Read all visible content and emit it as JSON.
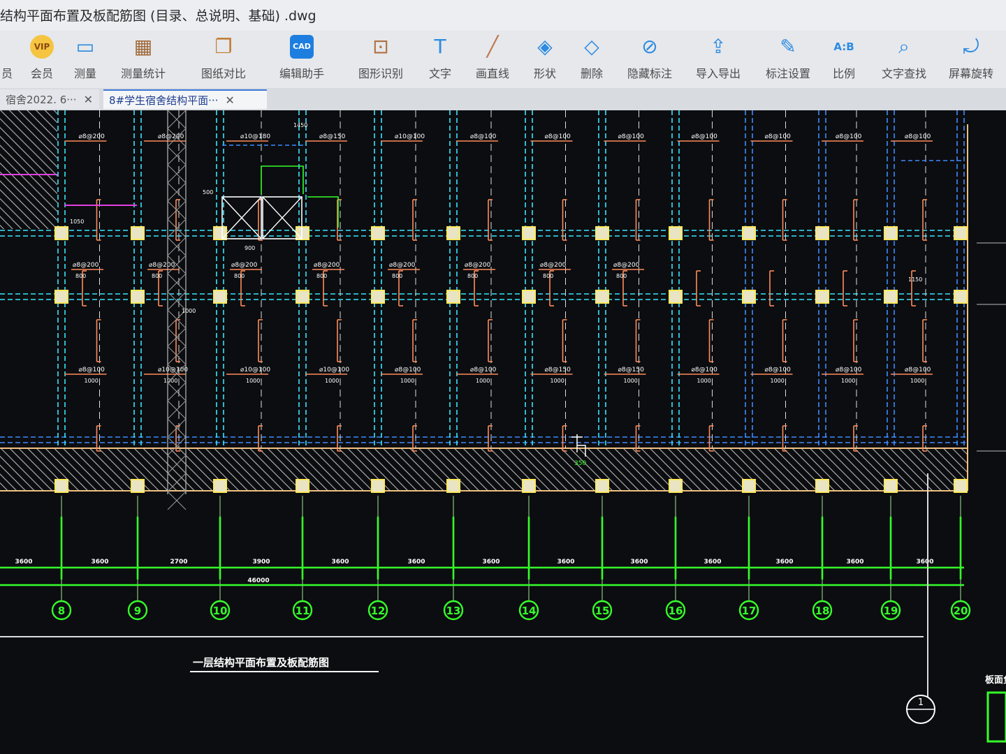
{
  "window": {
    "title": "结构平面布置及板配筋图 (目录、总说明、基础) .dwg"
  },
  "toolbar": {
    "items": [
      {
        "label": "员",
        "icon": "user-icon"
      },
      {
        "label": "会员",
        "icon": "vip-icon"
      },
      {
        "label": "测量",
        "icon": "ruler-icon"
      },
      {
        "label": "测量统计",
        "icon": "measure-stats-icon"
      },
      {
        "label": "图纸对比",
        "icon": "compare-icon"
      },
      {
        "label": "编辑助手",
        "icon": "cad-edit-icon"
      },
      {
        "label": "图形识别",
        "icon": "shape-recognize-icon"
      },
      {
        "label": "文字",
        "icon": "text-icon"
      },
      {
        "label": "画直线",
        "icon": "line-icon"
      },
      {
        "label": "形状",
        "icon": "shape-icon"
      },
      {
        "label": "删除",
        "icon": "eraser-icon"
      },
      {
        "label": "隐藏标注",
        "icon": "hide-annotation-icon"
      },
      {
        "label": "导入导出",
        "icon": "import-export-icon"
      },
      {
        "label": "标注设置",
        "icon": "annotation-settings-icon"
      },
      {
        "label": "比例",
        "icon": "scale-icon"
      },
      {
        "label": "文字查找",
        "icon": "text-search-icon"
      },
      {
        "label": "屏幕旋转",
        "icon": "rotate-screen-icon"
      }
    ],
    "vip_badge": "VIP",
    "scale_glyph": "A:B",
    "cad_glyph": "CAD"
  },
  "tabs": [
    {
      "label": "宿舍2022. 6···"
    },
    {
      "label": "8#学生宿舍结构平面···"
    }
  ],
  "drawing": {
    "axis_labels": [
      "8",
      "9",
      "10",
      "11",
      "12",
      "13",
      "14",
      "15",
      "16",
      "17",
      "18",
      "19",
      "20"
    ],
    "span_dims": [
      "3600",
      "3600",
      "2700",
      "3900",
      "3600",
      "3600",
      "3600",
      "3600",
      "3600",
      "3600",
      "3600",
      "3600",
      "3600"
    ],
    "total_dim": "46000",
    "drawing_title": "一层结构平面布置及板配筋图",
    "row_axis_label": "1",
    "side_label": "板面负",
    "rebar_top": [
      "⌀8@200",
      "⌀8@200",
      "⌀10@180",
      "⌀8@150",
      "⌀10@100",
      "⌀8@100",
      "⌀8@100",
      "⌀8@100",
      "⌀8@100",
      "⌀8@100",
      "⌀8@100",
      "⌀8@100",
      "⌀8@100"
    ],
    "rebar_mid": [
      "⌀8@200",
      "⌀8@200",
      "⌀8@200",
      "⌀8@200",
      "⌀8@200",
      "⌀8@200",
      "⌀8@200",
      "⌀8@200"
    ],
    "rebar_bot": [
      "⌀8@100",
      "⌀10@100",
      "⌀10@100",
      "⌀10@100",
      "⌀8@100",
      "⌀8@100",
      "⌀8@150",
      "⌀8@150",
      "⌀8@100",
      "⌀8@100",
      "⌀8@100",
      "⌀8@100",
      "⌀8@100"
    ],
    "mid_len": "800",
    "bot_len": "1000",
    "small_dims": [
      "1450",
      "1050",
      "500",
      "1000",
      "900",
      "1150"
    ],
    "cursor_dim": "350",
    "colors": {
      "grid_green": "#35ff2a",
      "beam_cyan": "#38e6ff",
      "beam_blue": "#3d8cff",
      "rebar_orange": "#ff8c5a",
      "column_yellow": "#ffe95a",
      "hatch_grey": "#b8b8b8",
      "background": "#0c0d10"
    }
  }
}
